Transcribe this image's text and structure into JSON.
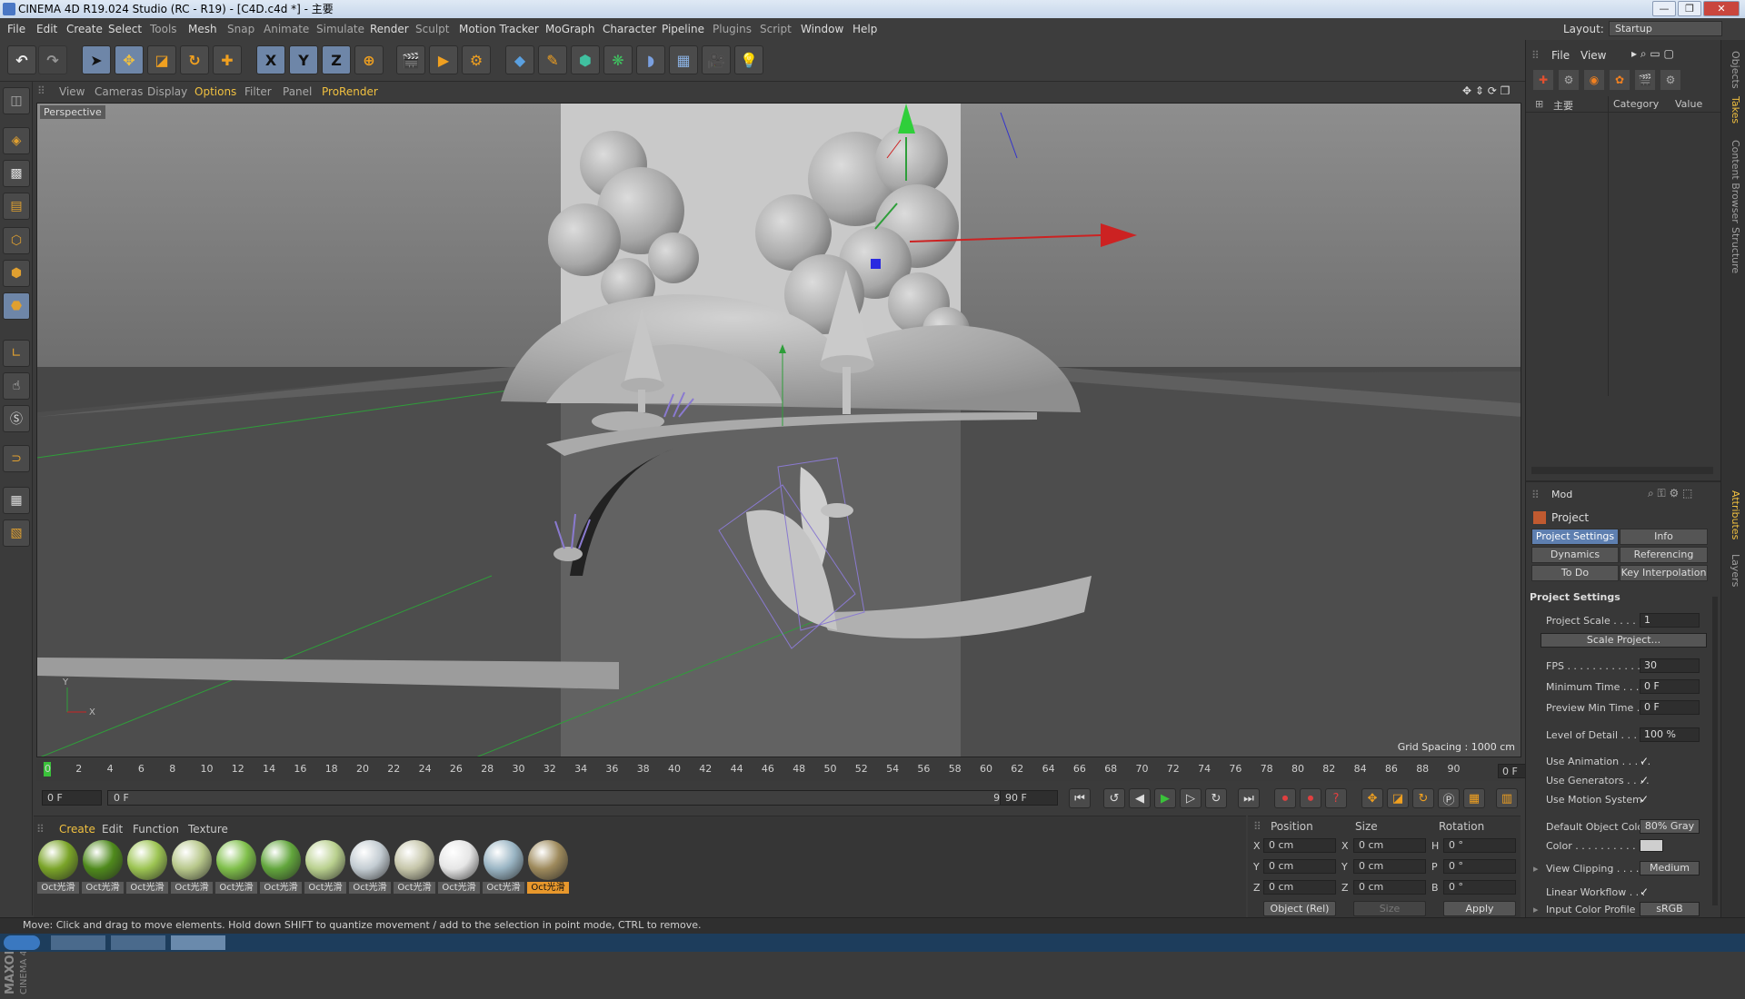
{
  "window": {
    "title": "CINEMA 4D R19.024 Studio (RC - R19) - [C4D.c4d *] - 主要",
    "minimize": "—",
    "maximize": "❐",
    "close": "✕"
  },
  "menubar": {
    "items": [
      "File",
      "Edit",
      "Create",
      "Select",
      "Tools",
      "Mesh",
      "Snap",
      "Animate",
      "Simulate",
      "Render",
      "Sculpt",
      "Motion Tracker",
      "MoGraph",
      "Character",
      "Pipeline",
      "Plugins",
      "Script",
      "Window",
      "Help"
    ],
    "layout_label": "Layout:",
    "layout_value": "Startup"
  },
  "toolbar": {
    "icons": [
      "undo-icon",
      "redo-icon",
      "live-selection-icon",
      "move-icon",
      "scale-icon",
      "rotate-icon",
      "recent-tool-icon",
      "x-axis-lock-icon",
      "y-axis-lock-icon",
      "z-axis-lock-icon",
      "world-coordinates-icon",
      "render-view-icon",
      "render-picture-viewer-icon",
      "edit-render-settings-icon",
      "cube-icon",
      "pen-icon",
      "subdivision-icon",
      "cloner-icon",
      "deformer-icon",
      "floor-icon",
      "camera-icon",
      "light-icon"
    ],
    "axis_x": "X",
    "axis_y": "Y",
    "axis_z": "Z"
  },
  "viewport": {
    "menu": [
      "View",
      "Cameras",
      "Display",
      "Options",
      "Filter",
      "Panel",
      "ProRender"
    ],
    "camera_label": "Perspective",
    "grid_spacing": "Grid Spacing : 1000 cm",
    "axis_y": "Y",
    "axis_x": "X"
  },
  "timeline": {
    "ticks": [
      "0",
      "2",
      "4",
      "6",
      "8",
      "10",
      "12",
      "14",
      "16",
      "18",
      "20",
      "22",
      "24",
      "26",
      "28",
      "30",
      "32",
      "34",
      "36",
      "38",
      "40",
      "42",
      "44",
      "46",
      "48",
      "50",
      "52",
      "54",
      "56",
      "58",
      "60",
      "62",
      "64",
      "66",
      "68",
      "70",
      "72",
      "74",
      "76",
      "78",
      "80",
      "82",
      "84",
      "86",
      "88",
      "90"
    ],
    "current_frame": "0 F",
    "start_field": "0 F",
    "range_start": "0 F",
    "range_end": "90 F",
    "end_field": "90 F"
  },
  "materials": {
    "menu": [
      "Create",
      "Edit",
      "Function",
      "Texture"
    ],
    "items": [
      {
        "label": "Oct光滑",
        "color": "#7aa428"
      },
      {
        "label": "Oct光滑",
        "color": "#4f8a1c"
      },
      {
        "label": "Oct光滑",
        "color": "#9cc452"
      },
      {
        "label": "Oct光滑",
        "color": "#b7c78a"
      },
      {
        "label": "Oct光滑",
        "color": "#7fbf4a"
      },
      {
        "label": "Oct光滑",
        "color": "#62a63c"
      },
      {
        "label": "Oct光滑",
        "color": "#b9d08e"
      },
      {
        "label": "Oct光滑",
        "color": "#c3ccd2"
      },
      {
        "label": "Oct光滑",
        "color": "#c6c6aa"
      },
      {
        "label": "Oct光滑",
        "color": "#e6e6e6"
      },
      {
        "label": "Oct光滑",
        "color": "#9ab5c4"
      },
      {
        "label": "Oct光滑",
        "color": "#9e8a5c"
      }
    ]
  },
  "coordinates": {
    "headers": [
      "Position",
      "Size",
      "Rotation"
    ],
    "rows": [
      {
        "pos_label": "X",
        "pos": "0 cm",
        "size_label": "X",
        "size": "0 cm",
        "rot_label": "H",
        "rot": "0 °"
      },
      {
        "pos_label": "Y",
        "pos": "0 cm",
        "size_label": "Y",
        "size": "0 cm",
        "rot_label": "P",
        "rot": "0 °"
      },
      {
        "pos_label": "Z",
        "pos": "0 cm",
        "size_label": "Z",
        "size": "0 cm",
        "rot_label": "B",
        "rot": "0 °"
      }
    ],
    "mode": "Object (Rel)",
    "size_mode": "Size",
    "apply": "Apply"
  },
  "object_manager": {
    "menu": [
      "File",
      "View"
    ],
    "columns": [
      "主要",
      "Category",
      "Value"
    ]
  },
  "attributes": {
    "mode_label": "Mod",
    "object_label": "Project",
    "tabs": [
      "Project Settings",
      "Info",
      "Dynamics",
      "Referencing",
      "To Do",
      "Key Interpolation"
    ],
    "section_title": "Project Settings",
    "scale_label": "Project Scale . . . . . .",
    "scale_value": "1",
    "scale_button": "Scale Project...",
    "fps_label": "FPS . . . . . . . . . . . . . .",
    "fps_value": "30",
    "min_time_label": "Minimum Time . . . .",
    "min_time_value": "0 F",
    "preview_min_label": "Preview Min Time . .",
    "preview_min_value": "0 F",
    "lod_label": "Level of Detail . . . . .",
    "lod_value": "100 %",
    "use_anim_label": "Use Animation . . . . .",
    "use_gen_label": "Use Generators . . . .",
    "use_motion_label": "Use Motion System",
    "check": "✓",
    "default_color_label": "Default Object Color",
    "default_color_value": "80% Gray",
    "color_label": "Color . . . . . . . . . . .",
    "clipping_label": "View Clipping . . . . .",
    "clipping_value": "Medium",
    "linear_label": "Linear Workflow . . .",
    "input_profile_label": "Input Color Profile . .",
    "input_profile_value": "sRGB"
  },
  "side_tabs": [
    "Objects",
    "Takes",
    "Content Browser",
    "Structure",
    "Attributes",
    "Layers"
  ],
  "status": "Move: Click and drag to move elements. Hold down SHIFT to quantize movement / add to the selection in point mode, CTRL to remove.",
  "colors": {
    "accent": "#f0c040",
    "selection": "#5e7fb0",
    "material_selected": "#e8982c"
  }
}
